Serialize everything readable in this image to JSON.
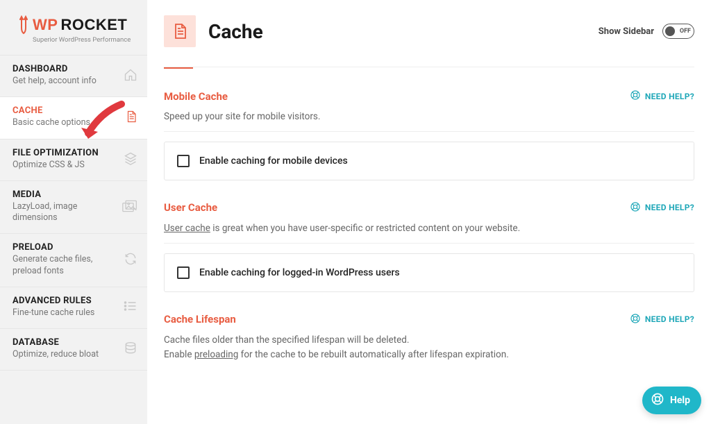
{
  "brand": {
    "wp": "WP",
    "rocket": "ROCKET",
    "tagline": "Superior WordPress Performance"
  },
  "sidebar": {
    "items": [
      {
        "title": "DASHBOARD",
        "desc": "Get help, account info"
      },
      {
        "title": "CACHE",
        "desc": "Basic cache options"
      },
      {
        "title": "FILE OPTIMIZATION",
        "desc": "Optimize CSS & JS"
      },
      {
        "title": "MEDIA",
        "desc": "LazyLoad, image dimensions"
      },
      {
        "title": "PRELOAD",
        "desc": "Generate cache files, preload fonts"
      },
      {
        "title": "ADVANCED RULES",
        "desc": "Fine-tune cache rules"
      },
      {
        "title": "DATABASE",
        "desc": "Optimize, reduce bloat"
      }
    ]
  },
  "header": {
    "title": "Cache",
    "show_sidebar": "Show Sidebar",
    "toggle_label": "OFF"
  },
  "help": {
    "need_help": "NEED HELP?",
    "pill": "Help"
  },
  "sections": {
    "mobile": {
      "title": "Mobile Cache",
      "sub": "Speed up your site for mobile visitors.",
      "opt": "Enable caching for mobile devices"
    },
    "user": {
      "title": "User Cache",
      "sub_link": "User cache",
      "sub_rest": " is great when you have user-specific or restricted content on your website.",
      "opt": "Enable caching for logged-in WordPress users"
    },
    "lifespan": {
      "title": "Cache Lifespan",
      "line1": "Cache files older than the specified lifespan will be deleted.",
      "line2a": "Enable ",
      "line2b": "preloading",
      "line2c": " for the cache to be rebuilt automatically after lifespan expiration."
    }
  }
}
